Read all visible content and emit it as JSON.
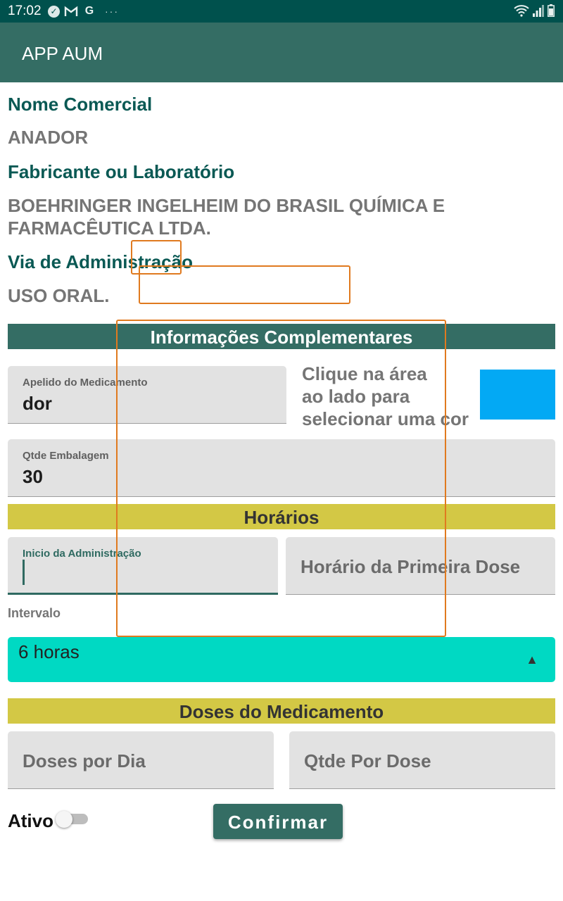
{
  "status_bar": {
    "time": "17:02",
    "left_icons": [
      "check-circle-icon",
      "gmail-icon",
      "google-icon"
    ],
    "overflow_dots": "···",
    "right_icons": [
      "wifi-icon",
      "signal-icon",
      "battery-icon"
    ]
  },
  "app_bar": {
    "title": "APP AUM"
  },
  "details": {
    "nome_comercial_label": "Nome Comercial",
    "nome_comercial_value": "ANADOR",
    "fabricante_label": "Fabricante ou Laboratório",
    "fabricante_value_line1": "BOEHRINGER INGELHEIM DO BRASIL QUÍMICA E",
    "fabricante_value_line2": "FARMACÊUTICA LTDA.",
    "via_label": "Via de Administração",
    "via_value": "USO ORAL."
  },
  "info_section": {
    "title": "Informações Complementares",
    "apelido_label": "Apelido do Medicamento",
    "apelido_value": "dor",
    "color_hint_line1": "Clique na área",
    "color_hint_line2": "ao lado para",
    "color_hint_line3": "selecionar uma cor",
    "selected_color": "#03a9f4",
    "qtde_embalagem_label": "Qtde Embalagem",
    "qtde_embalagem_value": "30"
  },
  "horarios_section": {
    "title": "Horários",
    "inicio_label": "Inicio da Administração",
    "inicio_value": "",
    "primeira_dose_hint": "Horário da Primeira Dose",
    "intervalo_label": "Intervalo",
    "intervalo_value": "6 horas"
  },
  "doses_section": {
    "title": "Doses do Medicamento",
    "doses_por_dia_hint": "Doses por Dia",
    "qtde_por_dose_hint": "Qtde Por Dose"
  },
  "footer": {
    "ativo_label": "Ativo",
    "ativo_on": false,
    "confirm_label": "Confirmar"
  },
  "colors": {
    "primary": "#346d64",
    "status_bar": "#00514d",
    "section_yellow": "#d3c845",
    "spinner_bg": "#00d9c3",
    "highlight_outline": "#e07a1f"
  }
}
